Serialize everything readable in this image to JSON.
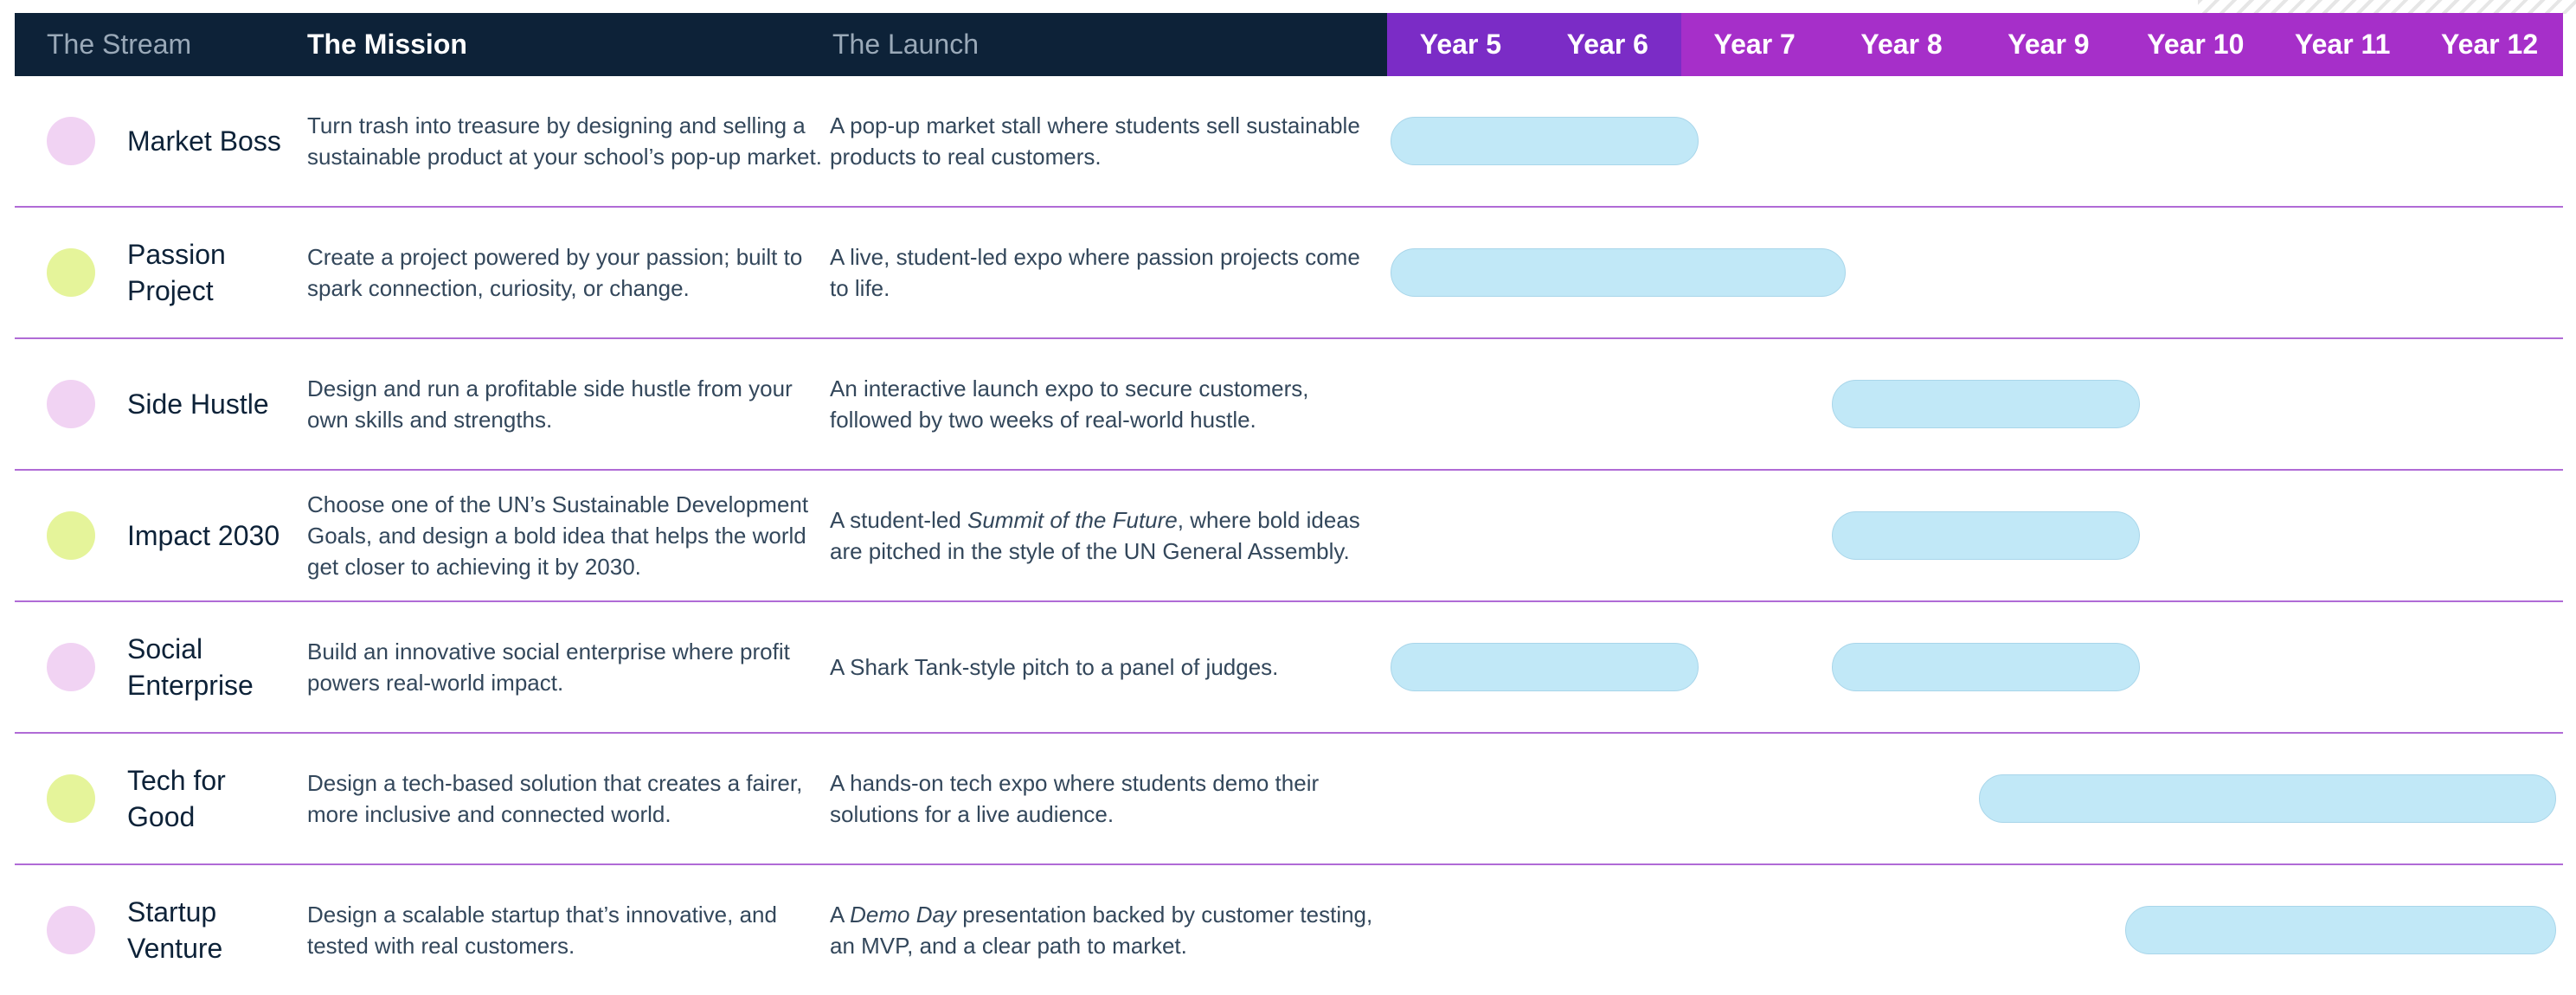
{
  "header": {
    "stream_label": "The Stream",
    "mission_label": "The Mission",
    "launch_label": "The Launch",
    "years": [
      {
        "label": "Year 5",
        "color": "#7b2cc6"
      },
      {
        "label": "Year 6",
        "color": "#7b2cc6"
      },
      {
        "label": "Year 7",
        "color": "#a62fc9"
      },
      {
        "label": "Year 8",
        "color": "#a62fc9"
      },
      {
        "label": "Year 9",
        "color": "#a62fc9"
      },
      {
        "label": "Year 10",
        "color": "#a62fc9"
      },
      {
        "label": "Year 11",
        "color": "#a62fc9"
      },
      {
        "label": "Year 12",
        "color": "#a62fc9"
      }
    ]
  },
  "colors": {
    "header_dark": "#0d2238",
    "dot_pink": "#f1d3f3",
    "dot_lime": "#e5f49a",
    "bar_fill": "#c1e8f7",
    "divider": "#b06bd6"
  },
  "streams": [
    {
      "name": "Market Boss",
      "dot": "pink",
      "mission": "Turn trash into treasure by designing and selling a sustainable product at your school’s pop-up market.",
      "launch": "A pop-up market stall where students sell sustainable products to real customers.",
      "bars": [
        {
          "from": "Year 5",
          "to": "Year 7"
        }
      ]
    },
    {
      "name": "Passion Project",
      "dot": "lime",
      "mission": "Create a project powered by your passion; built to spark connection, curiosity, or change.",
      "launch": "A live, student-led expo where passion projects come to life.",
      "bars": [
        {
          "from": "Year 5",
          "to": "Year 8"
        }
      ]
    },
    {
      "name": "Side Hustle",
      "dot": "pink",
      "mission": "Design and run a profitable side hustle from your own skills and strengths.",
      "launch": "An interactive launch expo to secure customers, followed by two weeks of real-world hustle.",
      "bars": [
        {
          "from": "Year 8",
          "to": "Year 10"
        }
      ]
    },
    {
      "name": "Impact 2030",
      "dot": "lime",
      "mission": "Choose one of the UN’s Sustainable Development Goals, and design a bold idea that helps the world get closer to achieving it by 2030.",
      "launch_pre": "A student-led ",
      "launch_em": "Summit of the Future",
      "launch_post": ", where bold ideas are pitched in the style of the UN General Assembly.",
      "bars": [
        {
          "from": "Year 8",
          "to": "Year 10"
        }
      ]
    },
    {
      "name": "Social Enterprise",
      "dot": "pink",
      "mission": "Build an innovative social enterprise where profit powers real-world impact.",
      "launch": "A Shark Tank-style pitch to a panel of judges.",
      "bars": [
        {
          "from": "Year 5",
          "to": "Year 7"
        },
        {
          "from": "Year 8",
          "to": "Year 10"
        }
      ]
    },
    {
      "name": "Tech for Good",
      "dot": "lime",
      "mission": "Design a tech-based solution that creates a fairer, more inclusive and connected world.",
      "launch": "A hands-on tech expo where students demo their solutions for a live audience.",
      "bars": [
        {
          "from": "Year 9",
          "to": "Year 12"
        }
      ]
    },
    {
      "name": "Startup Venture",
      "dot": "pink",
      "mission": "Design a scalable startup that’s innovative, and tested with real customers.",
      "launch_pre": "A ",
      "launch_em": "Demo Day",
      "launch_post": " presentation backed by customer testing, an MVP, and a clear path to market.",
      "bars": [
        {
          "from": "Year 10",
          "to": "Year 12"
        }
      ]
    }
  ]
}
